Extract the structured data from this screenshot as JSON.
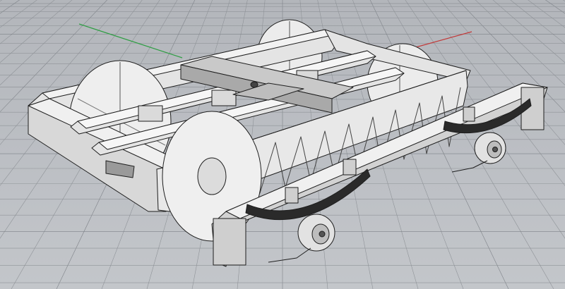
{
  "viewport": {
    "view_mode": "perspective",
    "display_mode": "shaded",
    "colors": {
      "background": "#b9bcc1",
      "grid_line": "#8f9398",
      "grid_major": "#7e8288",
      "x_axis": "#c23a3a",
      "y_axis": "#2f9e44",
      "model_fill": "#e4e4e4",
      "model_edge": "#1e1e1e",
      "spring": "#2a2a2a"
    }
  },
  "model": {
    "parts": [
      {
        "id": "side-frame-left",
        "icon": "side-frame-icon"
      },
      {
        "id": "side-frame-right",
        "icon": "side-frame-icon"
      },
      {
        "id": "bolster",
        "icon": "bolster-icon"
      },
      {
        "id": "wheelset-front",
        "icon": "wheel-icon"
      },
      {
        "id": "wheelset-rear",
        "icon": "wheel-icon"
      },
      {
        "id": "leaf-spring-front",
        "icon": "leaf-spring-icon"
      },
      {
        "id": "leaf-spring-rear",
        "icon": "leaf-spring-icon"
      },
      {
        "id": "axle-box-front",
        "icon": "axle-box-icon"
      },
      {
        "id": "axle-box-rear",
        "icon": "axle-box-icon"
      },
      {
        "id": "outer-frame",
        "icon": "outer-frame-icon"
      }
    ]
  }
}
